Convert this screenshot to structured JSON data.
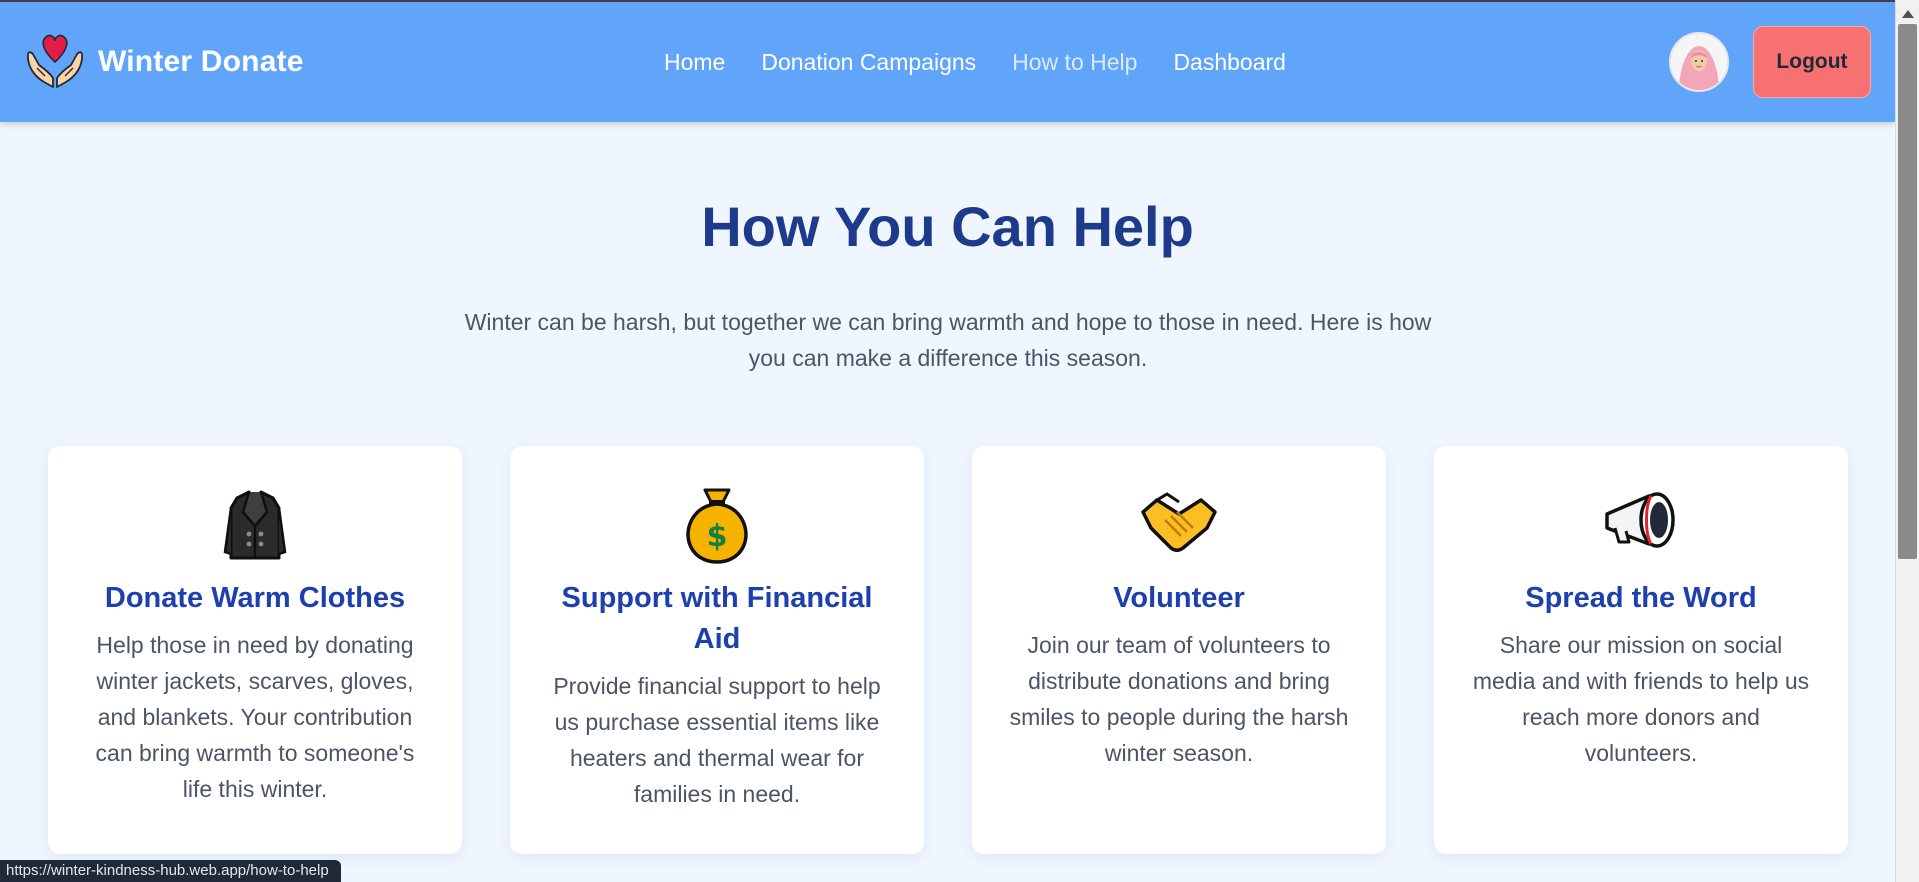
{
  "brand": {
    "name": "Winter Donate",
    "logo_icon": "heart-hands-icon"
  },
  "nav": {
    "links": [
      {
        "label": "Home",
        "active": false
      },
      {
        "label": "Donation Campaigns",
        "active": false
      },
      {
        "label": "How to Help",
        "active": true
      },
      {
        "label": "Dashboard",
        "active": false
      }
    ],
    "logout_label": "Logout",
    "avatar_icon": "user-avatar"
  },
  "main": {
    "title": "How You Can Help",
    "description": "Winter can be harsh, but together we can bring warmth and hope to those in need. Here is how you can make a difference this season.",
    "cards": [
      {
        "icon": "coat-icon",
        "title": "Donate Warm Clothes",
        "description": "Help those in need by donating winter jackets, scarves, gloves, and blankets. Your contribution can bring warmth to someone's life this winter."
      },
      {
        "icon": "money-bag-icon",
        "title": "Support with Financial Aid",
        "description": "Provide financial support to help us purchase essential items like heaters and thermal wear for families in need."
      },
      {
        "icon": "handshake-icon",
        "title": "Volunteer",
        "description": "Join our team of volunteers to distribute donations and bring smiles to people during the harsh winter season."
      },
      {
        "icon": "megaphone-icon",
        "title": "Spread the Word",
        "description": "Share our mission on social media and with friends to help us reach more donors and volunteers."
      }
    ]
  },
  "status_bar": {
    "url": "https://winter-kindness-hub.web.app/how-to-help"
  },
  "colors": {
    "navbar": "#60a5fa",
    "page_background": "#eff6ff",
    "title": "#1e3a8a",
    "card_title": "#1e40af",
    "logout_button": "#f87171"
  }
}
